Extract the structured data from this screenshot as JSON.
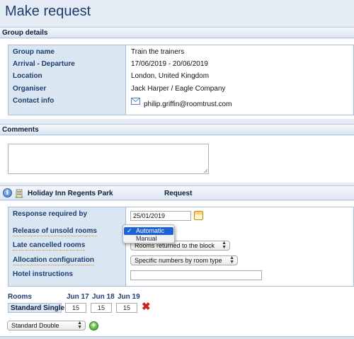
{
  "page_title": "Make request",
  "group_details": {
    "heading": "Group details",
    "rows": [
      {
        "label": "Group name",
        "value": "Train the trainers"
      },
      {
        "label": "Arrival - Departure",
        "value": "17/06/2019 - 20/06/2019"
      },
      {
        "label": "Location",
        "value": "London, United Kingdom"
      },
      {
        "label": "Organiser",
        "value": "Jack Harper / Eagle Company"
      },
      {
        "label": "Contact info",
        "value": "philip.griffin@roomtrust.com"
      }
    ]
  },
  "comments": {
    "heading": "Comments",
    "value": ""
  },
  "hotel": {
    "name": "Holiday Inn Regents Park",
    "column_label": "Request",
    "info_icon_glyph": "i"
  },
  "request": {
    "response_required_by": {
      "label": "Response required by",
      "value": "25/01/2019"
    },
    "release_unsold": {
      "label": "Release of unsold rooms",
      "options": [
        {
          "label": "Automatic",
          "selected": true
        },
        {
          "label": "Manual",
          "selected": false
        }
      ],
      "check_glyph": "✓"
    },
    "late_cancelled": {
      "label": "Late cancelled rooms",
      "value": "Rooms returned to the block"
    },
    "allocation": {
      "label": "Allocation configuration",
      "value": "Specific numbers by room type"
    },
    "hotel_instructions": {
      "label": "Hotel instructions",
      "value": ""
    }
  },
  "rooms": {
    "heading": "Rooms",
    "dates": [
      "Jun 17",
      "Jun 18",
      "Jun 19"
    ],
    "items": [
      {
        "type": "Standard Single",
        "quantities": [
          "15",
          "15",
          "15"
        ]
      }
    ],
    "add_select_value": "Standard Double",
    "delete_glyph": "✖",
    "add_glyph": "+"
  },
  "colors": {
    "title": "#1d3d6e",
    "label_bg": "#dbe6f3",
    "accent_dotted": "#d18a1e",
    "dropdown_selected": "#1e63d4",
    "delete": "#d0201c",
    "add": "#3f9a22"
  }
}
